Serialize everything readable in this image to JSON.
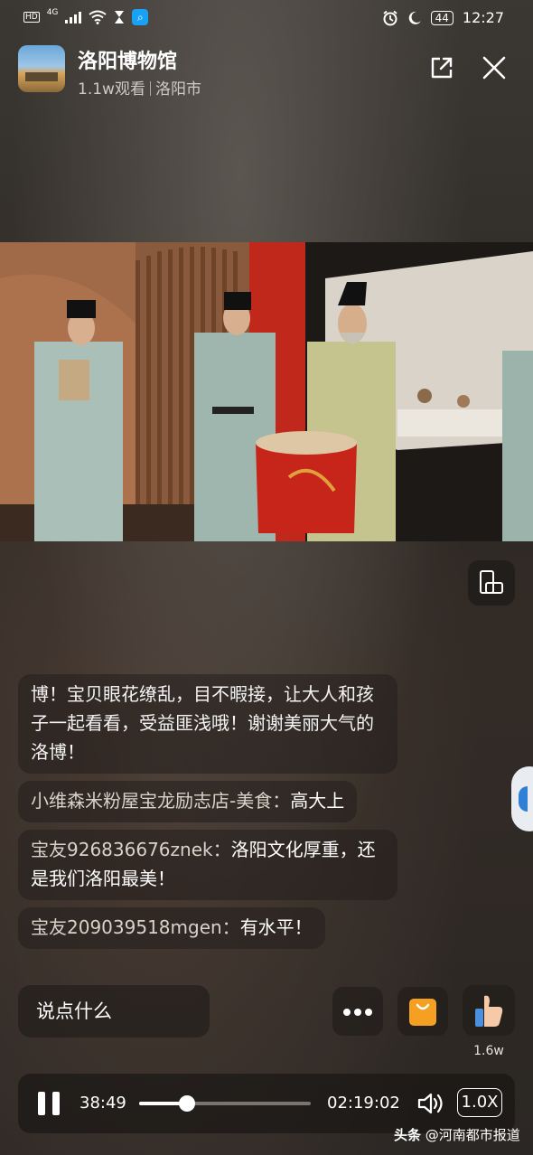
{
  "status_bar": {
    "hd": "HD",
    "network": "4G",
    "battery": "44",
    "time": "12:27"
  },
  "header": {
    "title": "洛阳博物馆",
    "views": "1.1w观看",
    "city": "洛阳市",
    "share_icon": "external-link-icon",
    "close_icon": "close-icon"
  },
  "comments": [
    {
      "text": "博！宝贝眼花缭乱，目不暇接，让大人和孩子一起看看，受益匪浅哦！谢谢美丽大气的洛博！"
    },
    {
      "user": "小维森米粉屋宝龙励志店-美食：",
      "text": "高大上"
    },
    {
      "user": "宝友926836676znek：",
      "text": "洛阳文化厚重，还是我们洛阳最美！"
    },
    {
      "user": "宝友209039518mgen：",
      "text": "有水平！"
    }
  ],
  "actions": {
    "say_placeholder": "说点什么",
    "like_count": "1.6w"
  },
  "player": {
    "current_time": "38:49",
    "total_time": "02:19:02",
    "progress": 0.28,
    "speed": "1.0X"
  },
  "watermark": {
    "brand": "头条",
    "account": "@河南都市报道"
  }
}
